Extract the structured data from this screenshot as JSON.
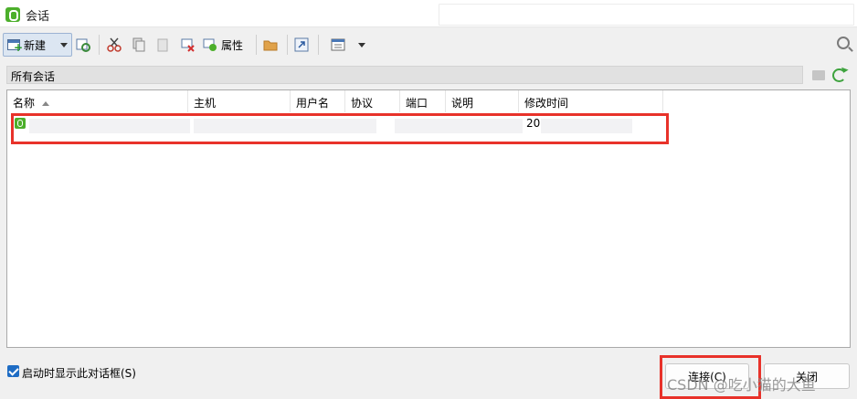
{
  "window": {
    "title": "会话",
    "close_glyph": "✕"
  },
  "toolbar": {
    "new_label": "新建",
    "properties_label": "属性",
    "search": {
      "value": "",
      "placeholder": ""
    }
  },
  "filter": {
    "label": "所有会话"
  },
  "list": {
    "columns": [
      "名称",
      "主机",
      "用户名",
      "协议",
      "端口",
      "说明",
      "修改时间"
    ],
    "row": {
      "name": "",
      "modified": "20"
    }
  },
  "footer": {
    "startup_checkbox_label": "启动时显示此对话框(S)",
    "connect_label": "连接(C)",
    "close_label": "关闭"
  },
  "watermark": "CSDN @吃小猫的大鱼",
  "colors": {
    "accent": "#1e6cc4",
    "highlight": "#e8322a",
    "brand_green": "#4caf2b"
  }
}
